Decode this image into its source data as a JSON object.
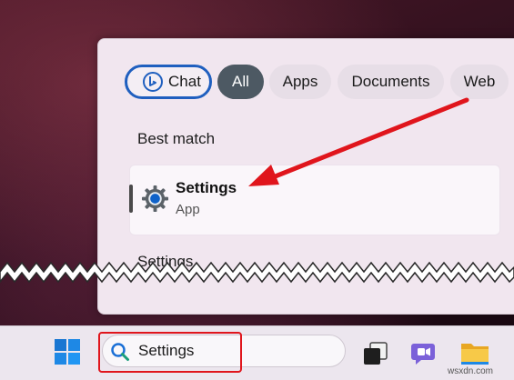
{
  "search_panel": {
    "filter_chips": [
      {
        "label": "Chat",
        "icon": "bing-icon",
        "state": "focused"
      },
      {
        "label": "All",
        "state": "selected"
      },
      {
        "label": "Apps"
      },
      {
        "label": "Documents"
      },
      {
        "label": "Web"
      }
    ],
    "best_match_title": "Best match",
    "best_match": {
      "name": "Settings",
      "type": "App",
      "icon": "gear-icon"
    },
    "settings_section_title": "Settings"
  },
  "taskbar": {
    "start_icon": "windows-logo-icon",
    "search": {
      "value": "Settings",
      "icon": "search-icon"
    },
    "pinned": [
      {
        "name": "task-view",
        "icon": "task-view-icon"
      },
      {
        "name": "teams-chat",
        "icon": "teams-chat-icon"
      },
      {
        "name": "file-explorer",
        "icon": "folder-icon"
      }
    ]
  },
  "annotation": {
    "arrow_color": "#e0151c",
    "highlight_color": "#e0151c"
  },
  "watermark": "wsxdn.com",
  "colors": {
    "accent": "#1f5fbf",
    "all_chip": "#4d5963",
    "gear": "#0f62c9"
  }
}
